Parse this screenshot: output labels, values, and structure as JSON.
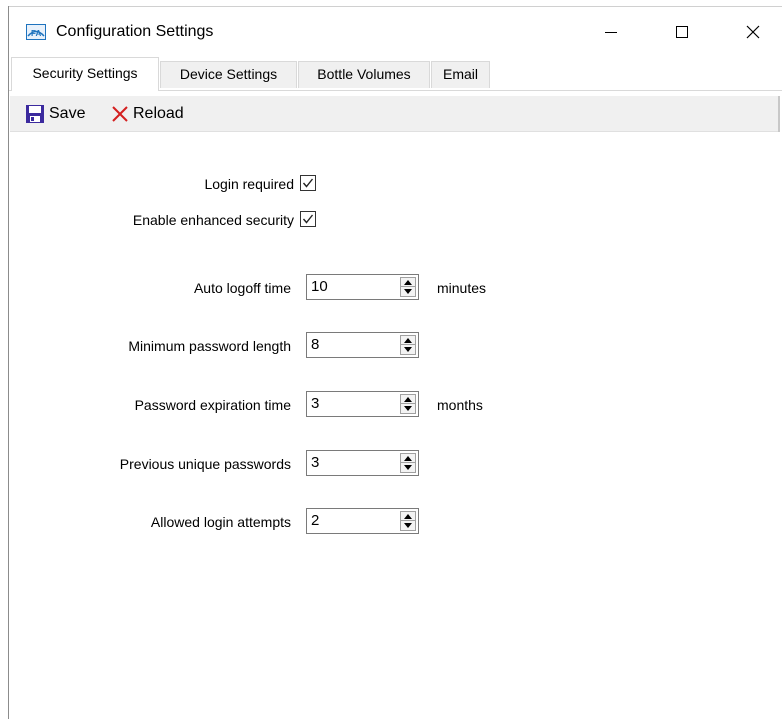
{
  "window": {
    "title": "Configuration Settings",
    "icon": "app-logo-icon",
    "controls": [
      "minimize-icon",
      "maximize-icon",
      "close-icon"
    ]
  },
  "tabs": [
    {
      "label": "Security Settings",
      "active": true
    },
    {
      "label": "Device Settings",
      "active": false
    },
    {
      "label": "Bottle Volumes",
      "active": false
    },
    {
      "label": "Email",
      "active": false
    }
  ],
  "toolbar": {
    "save_label": "Save",
    "reload_label": "Reload"
  },
  "security": {
    "login_required": {
      "label": "Login required",
      "checked": true
    },
    "enhanced_security": {
      "label": "Enable enhanced security",
      "checked": true
    },
    "auto_logoff": {
      "label": "Auto logoff time",
      "value": "10",
      "unit": "minutes"
    },
    "min_password_length": {
      "label": "Minimum password length",
      "value": "8"
    },
    "password_expiration": {
      "label": "Password expiration time",
      "value": "3",
      "unit": "months"
    },
    "previous_unique": {
      "label": "Previous unique passwords",
      "value": "3"
    },
    "login_attempts": {
      "label": "Allowed login attempts",
      "value": "2"
    }
  },
  "colors": {
    "save_icon": "#3b2a9e",
    "reload_icon": "#d42020",
    "app_icon": "#1e73be"
  }
}
